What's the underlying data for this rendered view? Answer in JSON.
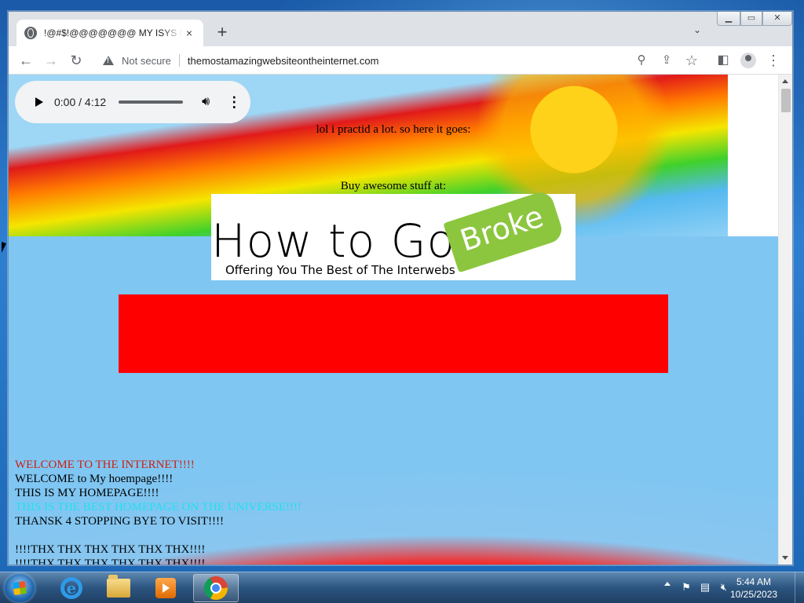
{
  "browser": {
    "tab_title": "!@#$!@@@@@@@ MY ISYS PR",
    "tab_close": "×",
    "new_tab": "+",
    "tab_menu": "⌄",
    "security_label": "Not secure",
    "url": "themostamazingwebsiteontheinternet.com",
    "window_controls": {
      "minimize": "▭",
      "maximize": "▭",
      "close": "✕"
    }
  },
  "page": {
    "audio": {
      "time": "0:00 / 4:12",
      "progress": 0
    },
    "intro_text": "lol i practid a lot. so here it goes:",
    "buy_text": "Buy awesome stuff at:",
    "logo": {
      "main": "How to Go",
      "tag": "Broke",
      "subtitle": "Offering You The Best of The Interwebs"
    },
    "lines": [
      {
        "text": "WELCOME TO THE INTERNET!!!!",
        "color": "#d02010"
      },
      {
        "text": "WELCOME to My hoempage!!!!",
        "color": "#000000"
      },
      {
        "text": "THIS IS MY HOMEPAGE!!!!",
        "color": "#000000"
      },
      {
        "text": "THIS IS THE BEST HOMEPAGE ON THE UNIVERSE!!!!",
        "color": "#20e0f0"
      },
      {
        "text": "THANSK 4 STOPPING BYE TO VISIT!!!!",
        "color": "#000000"
      },
      {
        "text": "",
        "color": "#000000"
      },
      {
        "text": "!!!!THX THX THX THX THX THX!!!!",
        "color": "#000000"
      },
      {
        "text": "!!!!THX THX THX THX THX THX!!!!",
        "color": "#000000"
      }
    ]
  },
  "taskbar": {
    "apps": [
      "internet-explorer-icon",
      "file-explorer-icon",
      "media-player-icon",
      "chrome-icon"
    ],
    "clock_time": "5:44 AM",
    "clock_date": "10/25/2023"
  },
  "colors": {
    "accent_red": "#ff0000",
    "chrome_bg": "#dee1e6"
  }
}
